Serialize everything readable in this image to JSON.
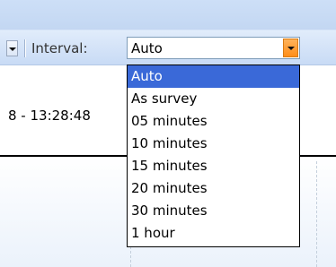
{
  "toolbar": {
    "interval_label": "Interval:",
    "interval_value": "Auto"
  },
  "content": {
    "time_text": "8 - 13:28:48"
  },
  "dropdown": {
    "options": [
      "Auto",
      "As survey",
      "05 minutes",
      "10 minutes",
      "15 minutes",
      "20 minutes",
      "30 minutes",
      "1 hour"
    ],
    "selected": "Auto"
  },
  "colors": {
    "selection": "#3a69d8",
    "combo_button": "#ff8e1a"
  }
}
